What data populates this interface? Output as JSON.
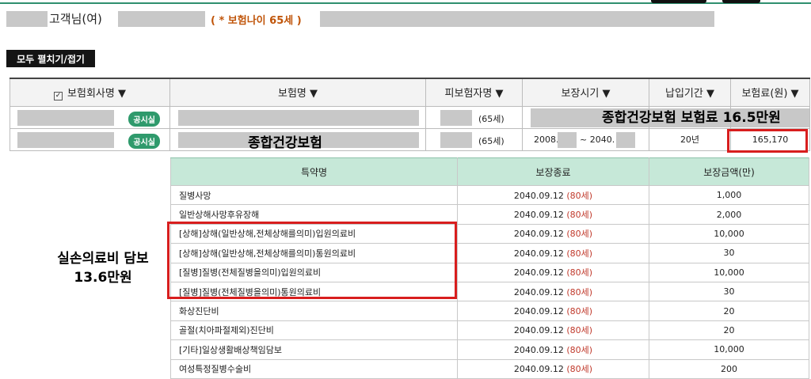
{
  "header": {
    "customer_suffix": "고객님(여)",
    "insurance_age_note": "( * 보험나이 65세 )"
  },
  "toolbar": {
    "toggle_all_label": "모두 펼치기/접기"
  },
  "main_table": {
    "headers": [
      "보험회사명 ▼",
      "보험명 ▼",
      "피보험자명 ▼",
      "보장시기 ▼",
      "납입기간 ▼",
      "보험료(원) ▼"
    ],
    "checkbox_mark": "✓",
    "rows": [
      {
        "badge": "공시실",
        "age": "(65세)",
        "period_start": "",
        "period_end": "",
        "pay_term": "",
        "premium": ""
      },
      {
        "badge": "공시실",
        "age": "(65세)",
        "period_start": "2008.",
        "period_sep": "~ 2040.",
        "pay_term": "20년",
        "premium": "165,170"
      }
    ]
  },
  "overlays": {
    "product_name": "종합건강보험",
    "premium_note": "종합건강보험 보험료 16.5만원",
    "side_note_line1": "실손의료비 담보",
    "side_note_line2": "13.6만원"
  },
  "rider_table": {
    "headers": [
      "특약명",
      "보장종료",
      "보장금액(만)"
    ],
    "rows": [
      {
        "name": "질병사망",
        "end_date": "2040.09.12",
        "age": "(80세)",
        "amount": "1,000"
      },
      {
        "name": "일반상해사망후유장해",
        "end_date": "2040.09.12",
        "age": "(80세)",
        "amount": "2,000"
      },
      {
        "name": "[상해]상해(일반상해,전체상해를의미)입원의료비",
        "end_date": "2040.09.12",
        "age": "(80세)",
        "amount": "10,000"
      },
      {
        "name": "[상해]상해(일반상해,전체상해를의미)통원의료비",
        "end_date": "2040.09.12",
        "age": "(80세)",
        "amount": "30"
      },
      {
        "name": "[질병]질병(전체질병을의미)입원의료비",
        "end_date": "2040.09.12",
        "age": "(80세)",
        "amount": "10,000"
      },
      {
        "name": "[질병]질병(전체질병을의미)통원의료비",
        "end_date": "2040.09.12",
        "age": "(80세)",
        "amount": "30"
      },
      {
        "name": "화상진단비",
        "end_date": "2040.09.12",
        "age": "(80세)",
        "amount": "20"
      },
      {
        "name": "골절(치아파절제외)진단비",
        "end_date": "2040.09.12",
        "age": "(80세)",
        "amount": "20"
      },
      {
        "name": "[기타]일상생활배상책임담보",
        "end_date": "2040.09.12",
        "age": "(80세)",
        "amount": "10,000"
      },
      {
        "name": "여성특정질병수술비",
        "end_date": "2040.09.12",
        "age": "(80세)",
        "amount": "200"
      }
    ]
  },
  "colors": {
    "accent_green": "#2f9a6c",
    "header_green": "#c6e8d8",
    "highlight_red": "#d81e1e",
    "age_red": "#c0392b",
    "note_orange": "#c0550a"
  }
}
